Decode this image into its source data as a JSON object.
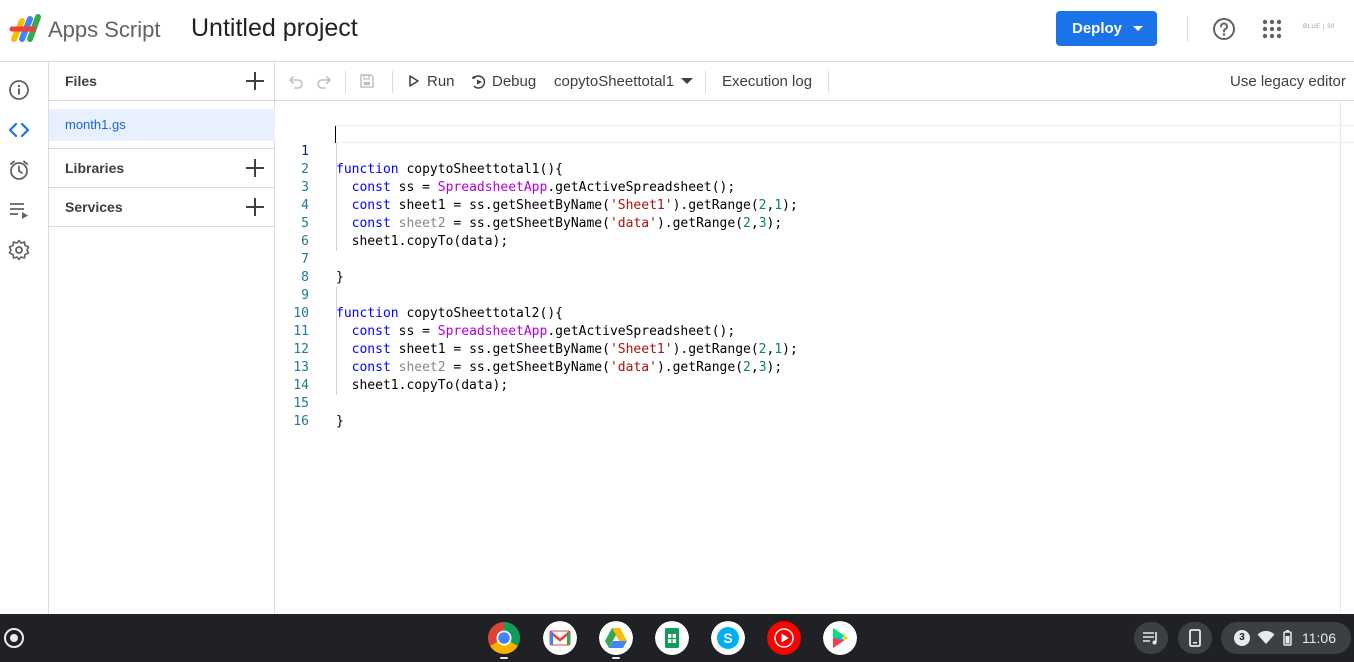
{
  "header": {
    "app_name": "Apps Script",
    "project_title": "Untitled project",
    "deploy_label": "Deploy",
    "account_badge": "BLUE | 30"
  },
  "files_panel": {
    "files_label": "Files",
    "files": [
      "month1.gs"
    ],
    "libraries_label": "Libraries",
    "services_label": "Services"
  },
  "toolbar": {
    "run_label": "Run",
    "debug_label": "Debug",
    "function_select": "copytoSheettotal1",
    "execution_log_label": "Execution log",
    "legacy_label": "Use legacy editor"
  },
  "editor": {
    "line_numbers": [
      "1",
      "2",
      "3",
      "4",
      "5",
      "6",
      "7",
      "8",
      "9",
      "10",
      "11",
      "12",
      "13",
      "14",
      "15",
      "16"
    ],
    "lines": [
      "function copytoSheettotal1(){",
      "  const ss = SpreadsheetApp.getActiveSpreadsheet();",
      "  const sheet1 = ss.getSheetByName('Sheet1').getRange(2,1);",
      "  const sheet2 = ss.getSheetByName('data').getRange(2,3);",
      "  sheet1.copyTo(data);",
      "",
      "}",
      "",
      "function copytoSheettotal2(){",
      "  const ss = SpreadsheetApp.getActiveSpreadsheet();",
      "  const sheet1 = ss.getSheetByName('Sheet1').getRange(2,1);",
      "  const sheet2 = ss.getSheetByName('data').getRange(2,3);",
      "  sheet1.copyTo(data);",
      "",
      "}",
      ""
    ]
  },
  "taskbar": {
    "apps": [
      "chrome-icon",
      "gmail-icon",
      "drive-icon",
      "sheets-icon",
      "skype-icon",
      "youtube-music-icon",
      "play-store-icon"
    ],
    "notification_count": "3",
    "time": "11:06"
  },
  "colors": {
    "accent": "#1a73e8",
    "selected_file_bg": "#e8f0fe",
    "keyword": "#0000ff",
    "class_name": "#af00db",
    "string": "#a31515",
    "number": "#098658"
  }
}
